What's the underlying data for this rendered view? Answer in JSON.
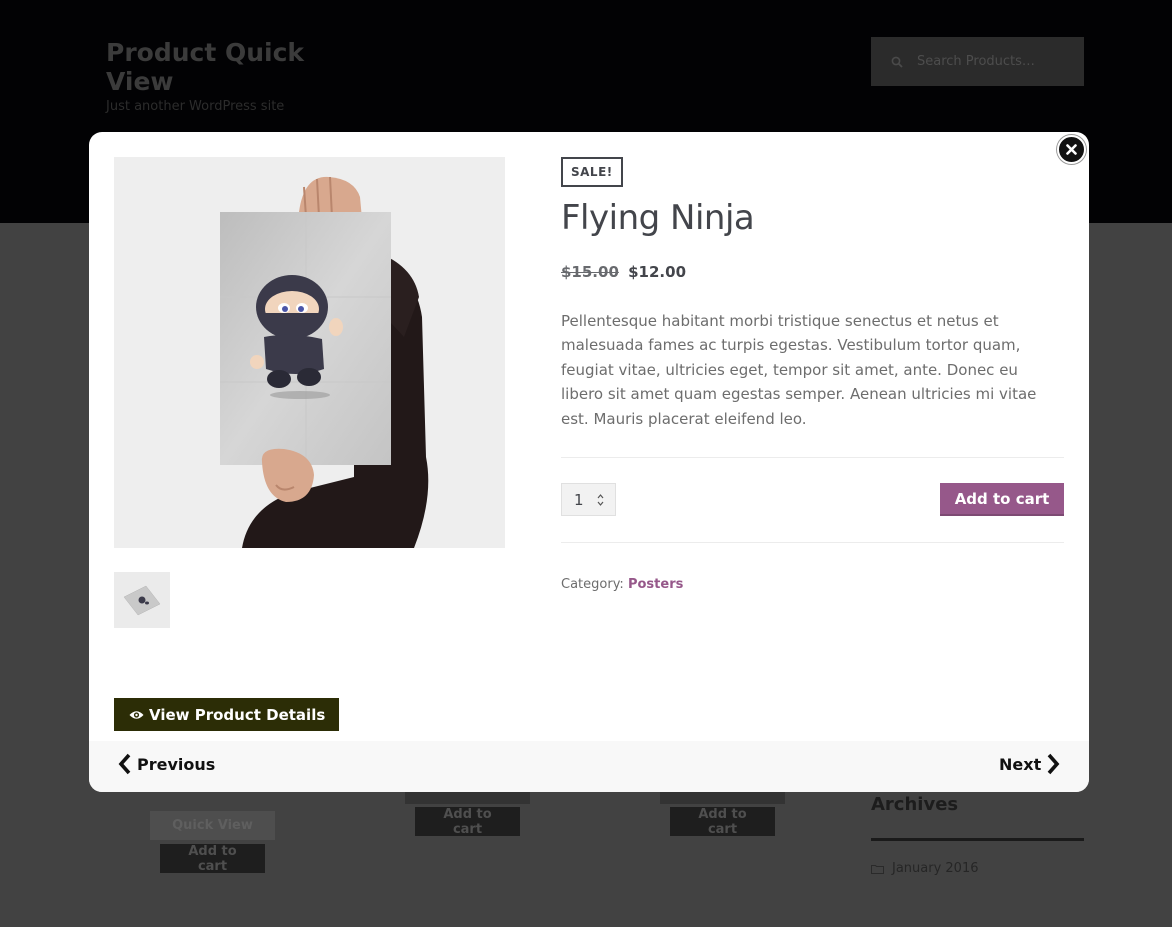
{
  "site": {
    "title": "Product Quick View",
    "tagline": "Just another WordPress site",
    "search_placeholder": "Search Products…"
  },
  "background_buttons": {
    "quick_view": "Quick View",
    "add_to_cart": "Add to cart"
  },
  "sidebar": {
    "archives_title": "Archives",
    "archive_items": [
      "January 2016"
    ]
  },
  "product": {
    "badge": "SALE!",
    "title": "Flying Ninja",
    "price_old": "$15.00",
    "price_new": "$12.00",
    "description": "Pellentesque habitant morbi tristique senectus et netus et malesuada fames ac turpis egestas. Vestibulum tortor quam, feugiat vitae, ultricies eget, tempor sit amet, ante. Donec eu libero sit amet quam egestas semper. Aenean ultricies mi vitae est. Mauris placerat eleifend leo.",
    "quantity": "1",
    "add_to_cart_label": "Add to cart",
    "category_label": "Category:",
    "category_value": "Posters"
  },
  "modal": {
    "view_details_label": "View Product Details",
    "prev_label": "Previous",
    "next_label": "Next"
  },
  "colors": {
    "accent": "#96588a",
    "details_button": "#2c2d06",
    "header_bg": "#020204"
  },
  "icons": [
    "search-icon",
    "close-icon",
    "eye-icon",
    "chevron-left-icon",
    "chevron-right-icon",
    "folder-icon",
    "spinner-arrows-icon"
  ]
}
